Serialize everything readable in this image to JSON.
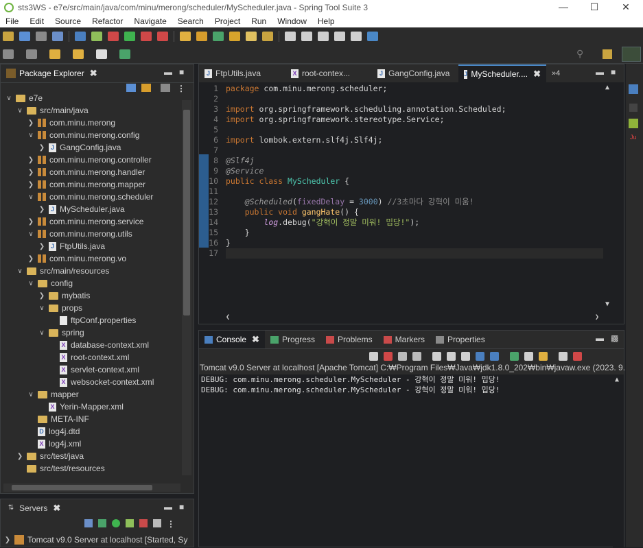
{
  "window": {
    "title": "sts3WS - e7e/src/main/java/com/minu/merong/scheduler/MyScheduler.java - Spring Tool Suite 3"
  },
  "menu": [
    "File",
    "Edit",
    "Source",
    "Refactor",
    "Navigate",
    "Search",
    "Project",
    "Run",
    "Window",
    "Help"
  ],
  "explorer": {
    "tab_label": "Package Explorer",
    "items": [
      {
        "label": "e7e",
        "depth": 0,
        "arrow": "down",
        "icon": "project"
      },
      {
        "label": "src/main/java",
        "depth": 1,
        "arrow": "down",
        "icon": "folder"
      },
      {
        "label": "com.minu.merong",
        "depth": 2,
        "arrow": "right",
        "icon": "package"
      },
      {
        "label": "com.minu.merong.config",
        "depth": 2,
        "arrow": "down",
        "icon": "package"
      },
      {
        "label": "GangConfig.java",
        "depth": 3,
        "arrow": "right",
        "icon": "java"
      },
      {
        "label": "com.minu.merong.controller",
        "depth": 2,
        "arrow": "right",
        "icon": "package"
      },
      {
        "label": "com.minu.merong.handler",
        "depth": 2,
        "arrow": "right",
        "icon": "package"
      },
      {
        "label": "com.minu.merong.mapper",
        "depth": 2,
        "arrow": "right",
        "icon": "package"
      },
      {
        "label": "com.minu.merong.scheduler",
        "depth": 2,
        "arrow": "down",
        "icon": "package"
      },
      {
        "label": "MyScheduler.java",
        "depth": 3,
        "arrow": "right",
        "icon": "java"
      },
      {
        "label": "com.minu.merong.service",
        "depth": 2,
        "arrow": "right",
        "icon": "package"
      },
      {
        "label": "com.minu.merong.utils",
        "depth": 2,
        "arrow": "down",
        "icon": "package"
      },
      {
        "label": "FtpUtils.java",
        "depth": 3,
        "arrow": "right",
        "icon": "java"
      },
      {
        "label": "com.minu.merong.vo",
        "depth": 2,
        "arrow": "right",
        "icon": "package"
      },
      {
        "label": "src/main/resources",
        "depth": 1,
        "arrow": "down",
        "icon": "folder"
      },
      {
        "label": "config",
        "depth": 2,
        "arrow": "down",
        "icon": "folder"
      },
      {
        "label": "mybatis",
        "depth": 3,
        "arrow": "right",
        "icon": "folder"
      },
      {
        "label": "props",
        "depth": 3,
        "arrow": "down",
        "icon": "folder"
      },
      {
        "label": "ftpConf.properties",
        "depth": 4,
        "arrow": "",
        "icon": "file"
      },
      {
        "label": "spring",
        "depth": 3,
        "arrow": "down",
        "icon": "folder"
      },
      {
        "label": "database-context.xml",
        "depth": 4,
        "arrow": "",
        "icon": "xml"
      },
      {
        "label": "root-context.xml",
        "depth": 4,
        "arrow": "",
        "icon": "xml"
      },
      {
        "label": "servlet-context.xml",
        "depth": 4,
        "arrow": "",
        "icon": "xml"
      },
      {
        "label": "websocket-context.xml",
        "depth": 4,
        "arrow": "",
        "icon": "xml"
      },
      {
        "label": "mapper",
        "depth": 2,
        "arrow": "down",
        "icon": "folder"
      },
      {
        "label": "Yerin-Mapper.xml",
        "depth": 3,
        "arrow": "",
        "icon": "xml"
      },
      {
        "label": "META-INF",
        "depth": 2,
        "arrow": "",
        "icon": "folder"
      },
      {
        "label": "log4j.dtd",
        "depth": 2,
        "arrow": "",
        "icon": "dtd"
      },
      {
        "label": "log4j.xml",
        "depth": 2,
        "arrow": "",
        "icon": "xml"
      },
      {
        "label": "src/test/java",
        "depth": 1,
        "arrow": "right",
        "icon": "folder"
      },
      {
        "label": "src/test/resources",
        "depth": 1,
        "arrow": "",
        "icon": "folder"
      }
    ]
  },
  "servers": {
    "tab_label": "Servers",
    "item": "Tomcat v9.0 Server at localhost  [Started, Sy"
  },
  "editor": {
    "tabs": [
      {
        "label": "FtpUtils.java",
        "icon": "java"
      },
      {
        "label": "root-contex...",
        "icon": "xml"
      },
      {
        "label": "GangConfig.java",
        "icon": "java"
      },
      {
        "label": "MyScheduler....",
        "icon": "java",
        "active": true
      }
    ],
    "overflow": "»4",
    "lines": [
      {
        "n": "1",
        "html": "<span class=\"kw\">package</span> com.minu.merong.scheduler;"
      },
      {
        "n": "2",
        "html": ""
      },
      {
        "n": "3",
        "html": "<span class=\"kw\">import</span> org.springframework.scheduling.annotation.Scheduled;"
      },
      {
        "n": "4",
        "html": "<span class=\"kw\">import</span> org.springframework.stereotype.Service;"
      },
      {
        "n": "5",
        "html": ""
      },
      {
        "n": "6",
        "html": "<span class=\"kw\">import</span> lombok.extern.slf4j.Slf4j;"
      },
      {
        "n": "7",
        "html": ""
      },
      {
        "n": "8",
        "html": "<span class=\"ann\">@Slf4j</span>"
      },
      {
        "n": "9",
        "html": "<span class=\"ann\">@Service</span>"
      },
      {
        "n": "10",
        "html": "<span class=\"kw\">public class</span> <span class=\"cls\">MyScheduler</span> {"
      },
      {
        "n": "11",
        "html": ""
      },
      {
        "n": "12",
        "html": "    <span class=\"ann\">@Scheduled</span>(<span class=\"fld\">fixedDelay</span> = <span class=\"num\">3000</span>) <span class=\"cmt\">//3초마다 강혁이 미움!</span>"
      },
      {
        "n": "13",
        "html": "    <span class=\"kw\">public void</span> <span class=\"mth\">gangHate</span>() {"
      },
      {
        "n": "14",
        "html": "        <span class=\"lg\">log</span>.debug(<span class=\"str\">\"강혁이 정말 미워! 밉당!\"</span>);"
      },
      {
        "n": "15",
        "html": "    }"
      },
      {
        "n": "16",
        "html": "}"
      },
      {
        "n": "17",
        "html": ""
      }
    ]
  },
  "console": {
    "tabs": [
      "Console",
      "Progress",
      "Problems",
      "Markers",
      "Properties"
    ],
    "header": "Tomcat v9.0 Server at localhost [Apache Tomcat] C:₩Program Files₩Java₩jdk1.8.0_202₩bin₩javaw.exe  (2023. 9.",
    "lines": [
      "DEBUG: com.minu.merong.scheduler.MyScheduler - 강혁이 정말 미워! 밉당!",
      "DEBUG: com.minu.merong.scheduler.MyScheduler - 강혁이 정말 미워! 밉당!"
    ]
  }
}
